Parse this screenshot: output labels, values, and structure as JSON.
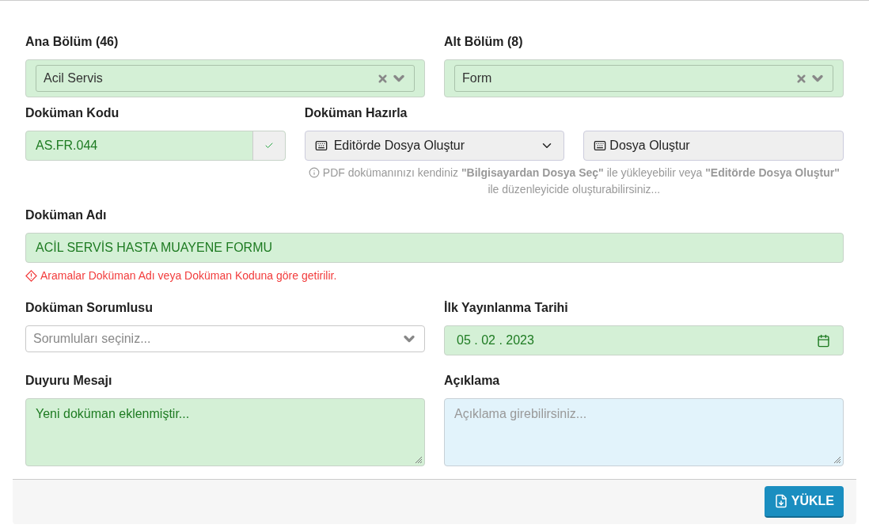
{
  "main_section": {
    "label": "Ana Bölüm (46)",
    "value": "Acil Servis",
    "valid": true
  },
  "sub_section": {
    "label": "Alt Bölüm (8)",
    "value": "Form",
    "valid": true
  },
  "document_code": {
    "label": "Doküman Kodu",
    "value": "AS.FR.044",
    "valid": true
  },
  "prepare": {
    "label": "Doküman Hazırla",
    "dropdown": "Editörde Dosya Oluştur",
    "button": "Dosya Oluştur",
    "help": "PDF dokümanınızı kendiniz **\"Bilgisayardan Dosya Seç\"** ile yükleyebilir veya **\"Editörde Dosya Oluştur\"** ile düzenleyicide oluşturabilirsiniz..."
  },
  "document_name": {
    "label": "Doküman Adı",
    "value": "ACİL SERVİS HASTA MUAYENE FORMU",
    "valid": true,
    "warning": "Aramalar Doküman Adı veya Doküman Koduna göre getirilir."
  },
  "responsible": {
    "label": "Doküman Sorumlusu",
    "placeholder": "Sorumluları seçiniz...",
    "valid": false
  },
  "publish_date": {
    "label": "İlk Yayınlanma Tarihi",
    "value": "05 . 02 . 2023",
    "valid": true
  },
  "announcement": {
    "label": "Duyuru Mesajı",
    "value": "Yeni doküman eklenmiştir...",
    "valid": true
  },
  "description": {
    "label": "Açıklama",
    "placeholder": "Açıklama girebilirsiniz...",
    "valid": false,
    "focused": true
  },
  "footer": {
    "button": "YÜKLE"
  }
}
